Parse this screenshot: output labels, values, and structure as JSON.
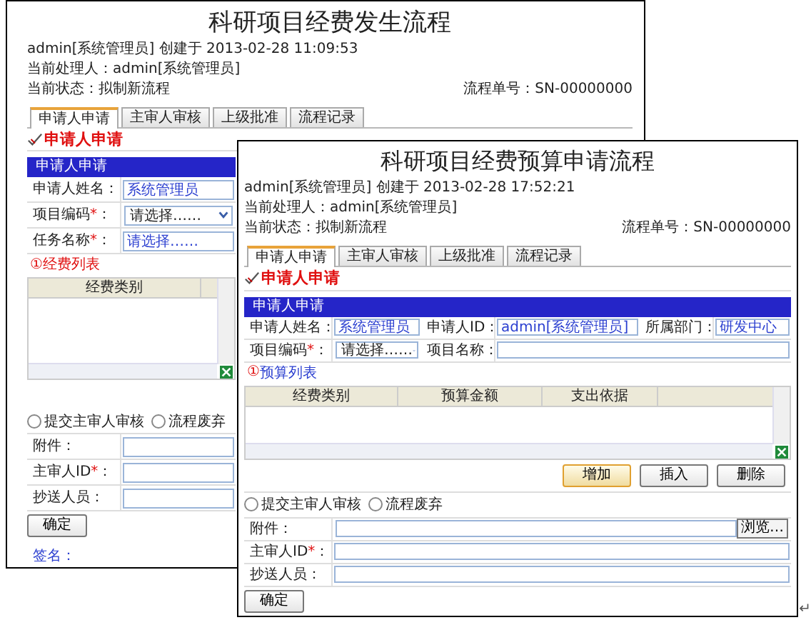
{
  "windows": [
    {
      "title": "科研项目经费发生流程",
      "created": "admin[系统管理员] 创建于 2013-02-28 11:09:53",
      "handler": "当前处理人：admin[系统管理员]",
      "status": "当前状态：拟制新流程",
      "flow_no": "流程单号：SN-00000000",
      "tabs": [
        {
          "label": "申请人申请",
          "selected": true
        },
        {
          "label": "主审人审核",
          "selected": false
        },
        {
          "label": "上级批准",
          "selected": false
        },
        {
          "label": "流程记录",
          "selected": false
        }
      ],
      "heading": "申请人申请",
      "section": {
        "title": "申请人申请",
        "rows": [
          [
            {
              "kind": "label",
              "text": "申请人姓名："
            },
            {
              "kind": "text",
              "value": "系统管理员"
            }
          ],
          [
            {
              "kind": "label",
              "text": "项目编码",
              "mark": "*",
              "colon": "："
            },
            {
              "kind": "select",
              "value": "请选择……"
            }
          ],
          [
            {
              "kind": "label",
              "text": "任务名称",
              "mark": "*",
              "colon": "："
            },
            {
              "kind": "text",
              "value": "请选择……"
            }
          ]
        ]
      },
      "list": {
        "marker": "①",
        "label": "经费列表",
        "columns": [
          "经费类别"
        ]
      },
      "radios": [
        {
          "label": "提交主审人审核",
          "checked": false
        },
        {
          "label": "流程废弃",
          "checked": false
        }
      ],
      "fields": [
        [
          {
            "kind": "label",
            "text": "附件："
          },
          {
            "kind": "text"
          }
        ],
        [
          {
            "kind": "label",
            "text": "主审人ID",
            "mark": "*",
            "colon": "："
          },
          {
            "kind": "text"
          }
        ],
        [
          {
            "kind": "label",
            "text": "抄送人员："
          },
          {
            "kind": "text"
          }
        ]
      ],
      "submit": "确定",
      "signature": "签名："
    },
    {
      "title": "科研项目经费预算申请流程",
      "created": "admin[系统管理员] 创建于 2013-02-28 17:52:21",
      "handler": "当前处理人：admin[系统管理员]",
      "status": "当前状态：拟制新流程",
      "flow_no": "流程单号：SN-00000000",
      "tabs": [
        {
          "label": "申请人申请",
          "selected": true
        },
        {
          "label": "主审人审核",
          "selected": false
        },
        {
          "label": "上级批准",
          "selected": false
        },
        {
          "label": "流程记录",
          "selected": false
        }
      ],
      "heading": "申请人申请",
      "section": {
        "title": "申请人申请",
        "rows": [
          [
            {
              "kind": "label",
              "text": "申请人姓名："
            },
            {
              "kind": "text",
              "value": "系统管理员"
            },
            {
              "kind": "label",
              "text": "申请人ID："
            },
            {
              "kind": "text",
              "value": "admin[系统管理员]"
            },
            {
              "kind": "label",
              "text": "所属部门："
            },
            {
              "kind": "text",
              "value": "研发中心"
            }
          ],
          [
            {
              "kind": "label",
              "text": "项目编码",
              "mark": "*",
              "colon": "："
            },
            {
              "kind": "select",
              "value": "请选择……"
            },
            {
              "kind": "label",
              "text": "项目名称："
            },
            {
              "kind": "text"
            }
          ]
        ]
      },
      "list": {
        "marker": "①",
        "label": "预算列表",
        "columns": [
          "经费类别",
          "预算金额",
          "支出依据"
        ]
      },
      "actions": [
        {
          "label": "增加",
          "highlighted": true
        },
        {
          "label": "插入",
          "highlighted": false
        },
        {
          "label": "删除",
          "highlighted": false
        }
      ],
      "radios": [
        {
          "label": "提交主审人审核",
          "checked": false
        },
        {
          "label": "流程废弃",
          "checked": false
        }
      ],
      "fields": [
        [
          {
            "kind": "label",
            "text": "附件："
          },
          {
            "kind": "file",
            "button": "浏览…"
          }
        ],
        [
          {
            "kind": "label",
            "text": "主审人ID",
            "mark": "*",
            "colon": "："
          },
          {
            "kind": "text"
          }
        ],
        [
          {
            "kind": "label",
            "text": "抄送人员："
          },
          {
            "kind": "text"
          }
        ]
      ],
      "submit": "确定"
    }
  ],
  "end_mark": "↵"
}
